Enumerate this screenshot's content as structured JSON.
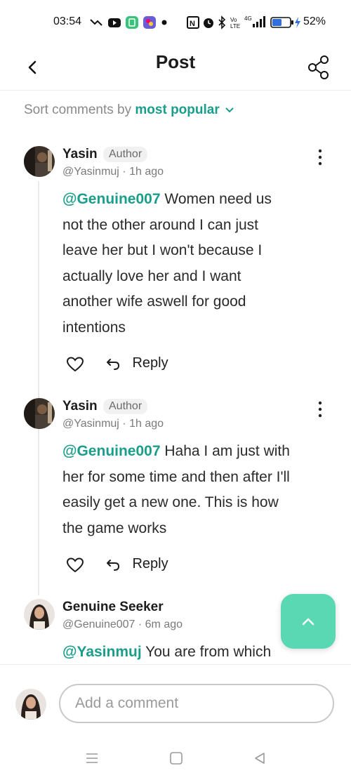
{
  "status_bar": {
    "time": "03:54",
    "battery": "52%",
    "network": "4G"
  },
  "header": {
    "title": "Post"
  },
  "sort": {
    "prefix": "Sort comments by",
    "value": "most popular"
  },
  "comments": [
    {
      "name": "Yasin",
      "badge": "Author",
      "handle": "@Yasinmuj",
      "time": "1h ago",
      "mention": "@Genuine007",
      "lines": [
        "Women need us",
        "not the other around I can just",
        "leave her but I won't because I",
        "actually love her and I want",
        "another wife aswell for good",
        "intentions"
      ],
      "reply_label": "Reply"
    },
    {
      "name": "Yasin",
      "badge": "Author",
      "handle": "@Yasinmuj",
      "time": "1h ago",
      "mention": "@Genuine007",
      "lines": [
        "Haha I am just with",
        "her for some time and then after I'll",
        "easily get a new one. This is how",
        "the game works"
      ],
      "reply_label": "Reply"
    },
    {
      "name": "Genuine Seeker",
      "handle": "@Genuine007",
      "time": "6m ago",
      "mention": "@Yasinmuj",
      "lines": [
        "You are from which"
      ]
    }
  ],
  "composer": {
    "placeholder": "Add a comment"
  },
  "colors": {
    "accent": "#1a9e8b",
    "fab": "#5ad8b4"
  }
}
